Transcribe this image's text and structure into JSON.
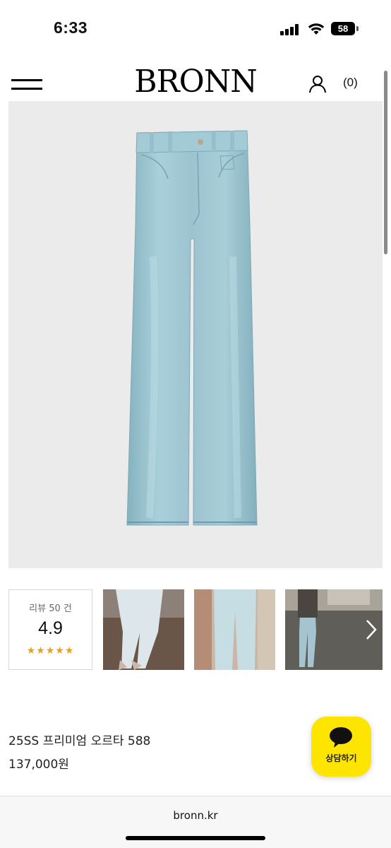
{
  "status_bar": {
    "time": "6:33",
    "battery": "58"
  },
  "header": {
    "logo": "BRONN",
    "cart_count": "(0)"
  },
  "hero": {
    "icon": "jeans-product-image",
    "background": "#ebebeb",
    "denim_color": "#9cc3cf"
  },
  "reviews": {
    "label": "리뷰 50 건",
    "score": "4.9",
    "stars": "★★★★★",
    "star_color": "#e8a020"
  },
  "thumbnails": [
    {
      "name": "thumbnail-1"
    },
    {
      "name": "thumbnail-2"
    },
    {
      "name": "thumbnail-3"
    }
  ],
  "product": {
    "name": "25SS 프리미엄 오르타 588",
    "price": "137,000원"
  },
  "chat": {
    "label": "상담하기",
    "color": "#fde500"
  },
  "browser": {
    "url": "bronn.kr"
  }
}
